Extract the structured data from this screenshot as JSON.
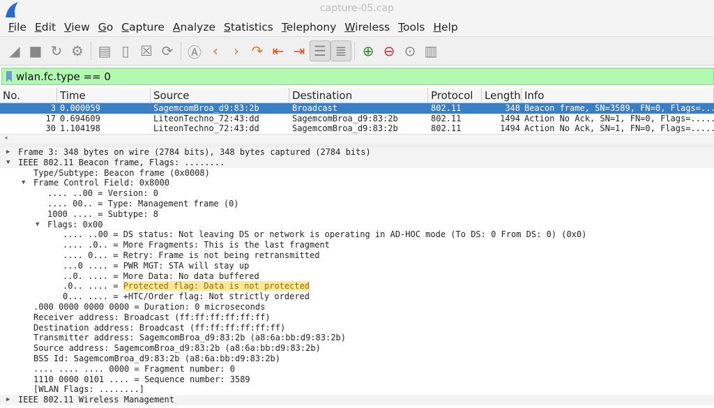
{
  "window": {
    "title": "capture-05.cap"
  },
  "menu": [
    "File",
    "Edit",
    "View",
    "Go",
    "Capture",
    "Analyze",
    "Statistics",
    "Telephony",
    "Wireless",
    "Tools",
    "Help"
  ],
  "toolbar": [
    {
      "icon": "start-capture-icon",
      "g": "◢"
    },
    {
      "icon": "stop-capture-icon",
      "g": "■"
    },
    {
      "icon": "restart-capture-icon",
      "g": "↻"
    },
    {
      "icon": "capture-options-icon",
      "g": "⚙"
    },
    {
      "sep": true
    },
    {
      "icon": "open-file-icon",
      "g": "▤"
    },
    {
      "icon": "save-file-icon",
      "g": "▯"
    },
    {
      "icon": "close-file-icon",
      "g": "☒"
    },
    {
      "icon": "reload-file-icon",
      "g": "⟳"
    },
    {
      "sep": true
    },
    {
      "icon": "find-packet-icon",
      "g": "Ⓐ"
    },
    {
      "icon": "go-back-icon",
      "g": "‹"
    },
    {
      "icon": "go-forward-icon",
      "g": "›"
    },
    {
      "icon": "go-to-packet-icon",
      "g": "↷"
    },
    {
      "icon": "first-packet-icon",
      "g": "⇤"
    },
    {
      "icon": "last-packet-icon",
      "g": "⇥"
    },
    {
      "icon": "autoscroll-icon",
      "g": "☰",
      "active": true
    },
    {
      "icon": "colorize-icon",
      "g": "≣",
      "active": true
    },
    {
      "sep": true
    },
    {
      "icon": "zoom-in-icon",
      "g": "⊕"
    },
    {
      "icon": "zoom-out-icon",
      "g": "⊖"
    },
    {
      "icon": "normal-size-icon",
      "g": "⊙"
    },
    {
      "icon": "resize-columns-icon",
      "g": "▥"
    }
  ],
  "filter": {
    "value": "wlan.fc.type == 0"
  },
  "packet_list": {
    "columns": [
      "No.",
      "Time",
      "Source",
      "Destination",
      "Protocol",
      "Length",
      "Info"
    ],
    "rows": [
      [
        "3",
        "0.000059",
        "SagemcomBroa_d9:83:2b",
        "Broadcast",
        "802.11",
        "348",
        "Beacon frame, SN=3589, FN=0, Flags=........"
      ],
      [
        "17",
        "0.694609",
        "LiteonTechno_72:43:dd",
        "SagemcomBroa_d9:83:2b",
        "802.11",
        "1494",
        "Action No Ack, SN=1, FN=0, Flags=........"
      ],
      [
        "30",
        "1.104198",
        "LiteonTechno_72:43:dd",
        "SagemcomBroa_d9:83:2b",
        "802.11",
        "1494",
        "Action No Ack, SN=1, FN=0, Flags=........"
      ]
    ],
    "selected_row": 0
  },
  "details": [
    {
      "lvl": 0,
      "arrow": "closed",
      "t": "Frame 3: 348 bytes on wire (2784 bits), 348 bytes captured (2784 bits)"
    },
    {
      "lvl": 0,
      "arrow": "open",
      "t": "IEEE 802.11 Beacon frame, Flags: ........"
    },
    {
      "lvl": 1,
      "t": "Type/Subtype: Beacon frame (0x0008)"
    },
    {
      "lvl": 1,
      "arrow": "open",
      "t": "Frame Control Field: 0x8000"
    },
    {
      "lvl": 2,
      "t": ".... ..00 = Version: 0"
    },
    {
      "lvl": 2,
      "t": ".... 00.. = Type: Management frame (0)"
    },
    {
      "lvl": 2,
      "t": "1000 .... = Subtype: 8"
    },
    {
      "lvl": 2,
      "arrow": "open",
      "t": "Flags: 0x00"
    },
    {
      "lvl": 3,
      "t": ".... ..00 = DS status: Not leaving DS or network is operating in AD-HOC mode (To DS: 0 From DS: 0) (0x0)"
    },
    {
      "lvl": 3,
      "t": ".... .0.. = More Fragments: This is the last fragment"
    },
    {
      "lvl": 3,
      "t": ".... 0... = Retry: Frame is not being retransmitted"
    },
    {
      "lvl": 3,
      "t": "...0 .... = PWR MGT: STA will stay up"
    },
    {
      "lvl": 3,
      "t": "..0. .... = More Data: No data buffered"
    },
    {
      "lvl": 3,
      "t": ".0.. .... = ",
      "hl": "Protected flag: Data is not protected"
    },
    {
      "lvl": 3,
      "t": "0... .... = +HTC/Order flag: Not strictly ordered"
    },
    {
      "lvl": 1,
      "t": ".000 0000 0000 0000 = Duration: 0 microseconds"
    },
    {
      "lvl": 1,
      "t": "Receiver address: Broadcast (ff:ff:ff:ff:ff:ff)"
    },
    {
      "lvl": 1,
      "t": "Destination address: Broadcast (ff:ff:ff:ff:ff:ff)"
    },
    {
      "lvl": 1,
      "t": "Transmitter address: SagemcomBroa_d9:83:2b (a8:6a:bb:d9:83:2b)"
    },
    {
      "lvl": 1,
      "t": "Source address: SagemcomBroa_d9:83:2b (a8:6a:bb:d9:83:2b)"
    },
    {
      "lvl": 1,
      "t": "BSS Id: SagemcomBroa_d9:83:2b (a8:6a:bb:d9:83:2b)"
    },
    {
      "lvl": 1,
      "t": ".... .... .... 0000 = Fragment number: 0"
    },
    {
      "lvl": 1,
      "t": "1110 0000 0101 .... = Sequence number: 3589"
    },
    {
      "lvl": 1,
      "t": "[WLAN Flags: ........]"
    },
    {
      "lvl": 0,
      "arrow": "closed",
      "t": "IEEE 802.11 Wireless Management"
    }
  ],
  "colors": {
    "filter_valid": "#b1f8b1",
    "selection": "#3a7fc4",
    "highlight": "#fbe89a"
  }
}
